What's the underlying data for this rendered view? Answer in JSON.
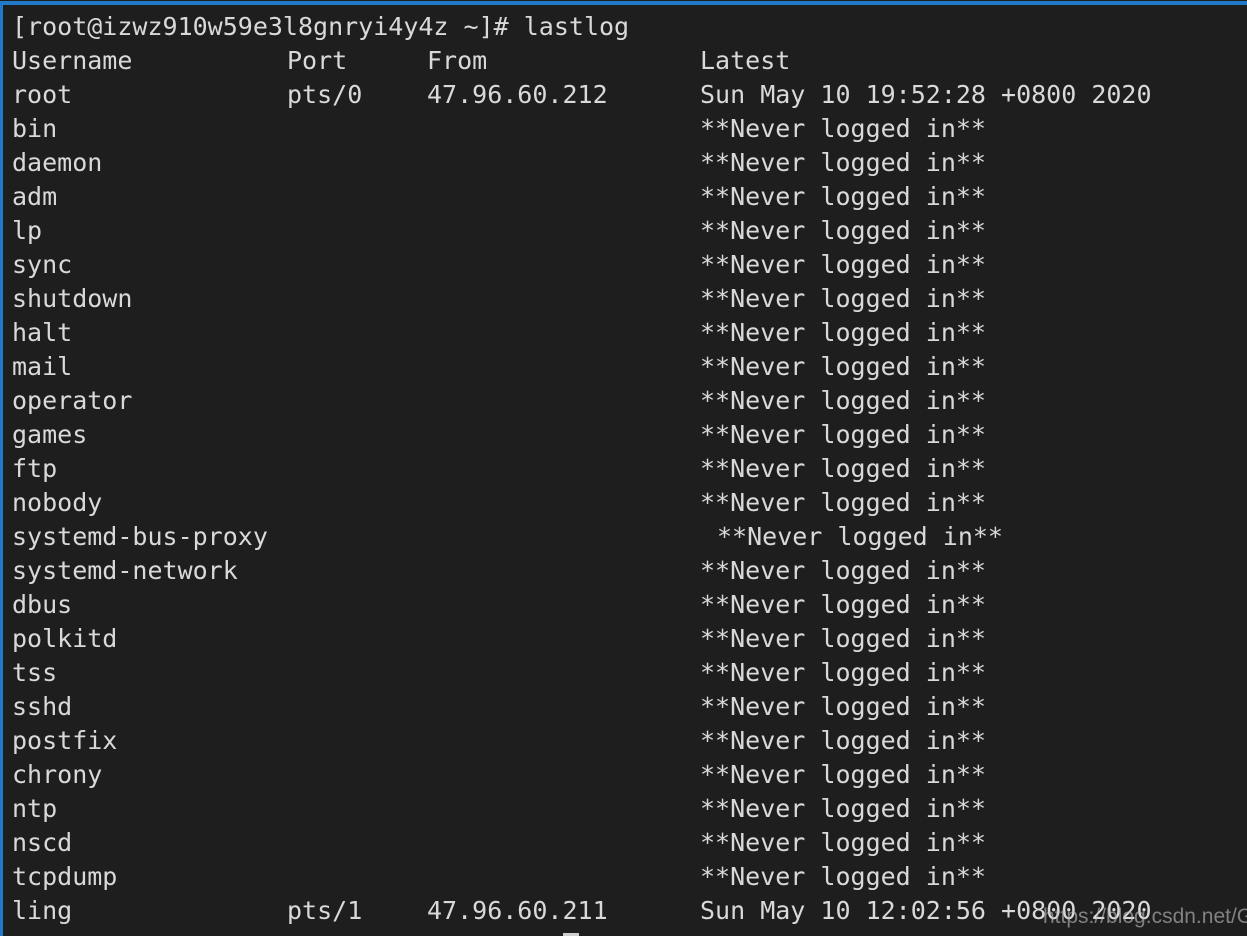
{
  "window": {
    "accent_color": "#1f7ac9",
    "background_color": "#1e1e1e",
    "foreground_color": "#d9d9d9"
  },
  "terminal": {
    "prompt": "[root@izwz910w59e3l8gnryi4y4z ~]# lastlog",
    "user": "root",
    "hostname": "izwz910w59e3l8gnryi4y4z",
    "working_directory": "~",
    "prompt_symbol": "#",
    "command": "lastlog",
    "cursor": "block"
  },
  "table": {
    "headers": {
      "username": "Username",
      "port": "Port",
      "from": "From",
      "latest": "Latest"
    },
    "never_logged_in": "**Never logged in**",
    "rows": [
      {
        "username": "root",
        "port": "pts/0",
        "from": "47.96.60.212",
        "latest": "Sun May 10 19:52:28 +0800 2020",
        "indented": false
      },
      {
        "username": "bin",
        "port": "",
        "from": "",
        "latest": "**Never logged in**",
        "indented": false
      },
      {
        "username": "daemon",
        "port": "",
        "from": "",
        "latest": "**Never logged in**",
        "indented": false
      },
      {
        "username": "adm",
        "port": "",
        "from": "",
        "latest": "**Never logged in**",
        "indented": false
      },
      {
        "username": "lp",
        "port": "",
        "from": "",
        "latest": "**Never logged in**",
        "indented": false
      },
      {
        "username": "sync",
        "port": "",
        "from": "",
        "latest": "**Never logged in**",
        "indented": false
      },
      {
        "username": "shutdown",
        "port": "",
        "from": "",
        "latest": "**Never logged in**",
        "indented": false
      },
      {
        "username": "halt",
        "port": "",
        "from": "",
        "latest": "**Never logged in**",
        "indented": false
      },
      {
        "username": "mail",
        "port": "",
        "from": "",
        "latest": "**Never logged in**",
        "indented": false
      },
      {
        "username": "operator",
        "port": "",
        "from": "",
        "latest": "**Never logged in**",
        "indented": false
      },
      {
        "username": "games",
        "port": "",
        "from": "",
        "latest": "**Never logged in**",
        "indented": false
      },
      {
        "username": "ftp",
        "port": "",
        "from": "",
        "latest": "**Never logged in**",
        "indented": false
      },
      {
        "username": "nobody",
        "port": "",
        "from": "",
        "latest": "**Never logged in**",
        "indented": false
      },
      {
        "username": "systemd-bus-proxy",
        "port": "",
        "from": "",
        "latest": "**Never logged in**",
        "indented": true
      },
      {
        "username": "systemd-network",
        "port": "",
        "from": "",
        "latest": "**Never logged in**",
        "indented": false
      },
      {
        "username": "dbus",
        "port": "",
        "from": "",
        "latest": "**Never logged in**",
        "indented": false
      },
      {
        "username": "polkitd",
        "port": "",
        "from": "",
        "latest": "**Never logged in**",
        "indented": false
      },
      {
        "username": "tss",
        "port": "",
        "from": "",
        "latest": "**Never logged in**",
        "indented": false
      },
      {
        "username": "sshd",
        "port": "",
        "from": "",
        "latest": "**Never logged in**",
        "indented": false
      },
      {
        "username": "postfix",
        "port": "",
        "from": "",
        "latest": "**Never logged in**",
        "indented": false
      },
      {
        "username": "chrony",
        "port": "",
        "from": "",
        "latest": "**Never logged in**",
        "indented": false
      },
      {
        "username": "ntp",
        "port": "",
        "from": "",
        "latest": "**Never logged in**",
        "indented": false
      },
      {
        "username": "nscd",
        "port": "",
        "from": "",
        "latest": "**Never logged in**",
        "indented": false
      },
      {
        "username": "tcpdump",
        "port": "",
        "from": "",
        "latest": "**Never logged in**",
        "indented": false
      },
      {
        "username": "ling",
        "port": "pts/1",
        "from": "47.96.60.211",
        "latest": "Sun May 10 12:02:56 +0800 2020",
        "indented": false
      }
    ]
  },
  "watermark": {
    "text": "https://blog.csdn.net/Geffin"
  }
}
